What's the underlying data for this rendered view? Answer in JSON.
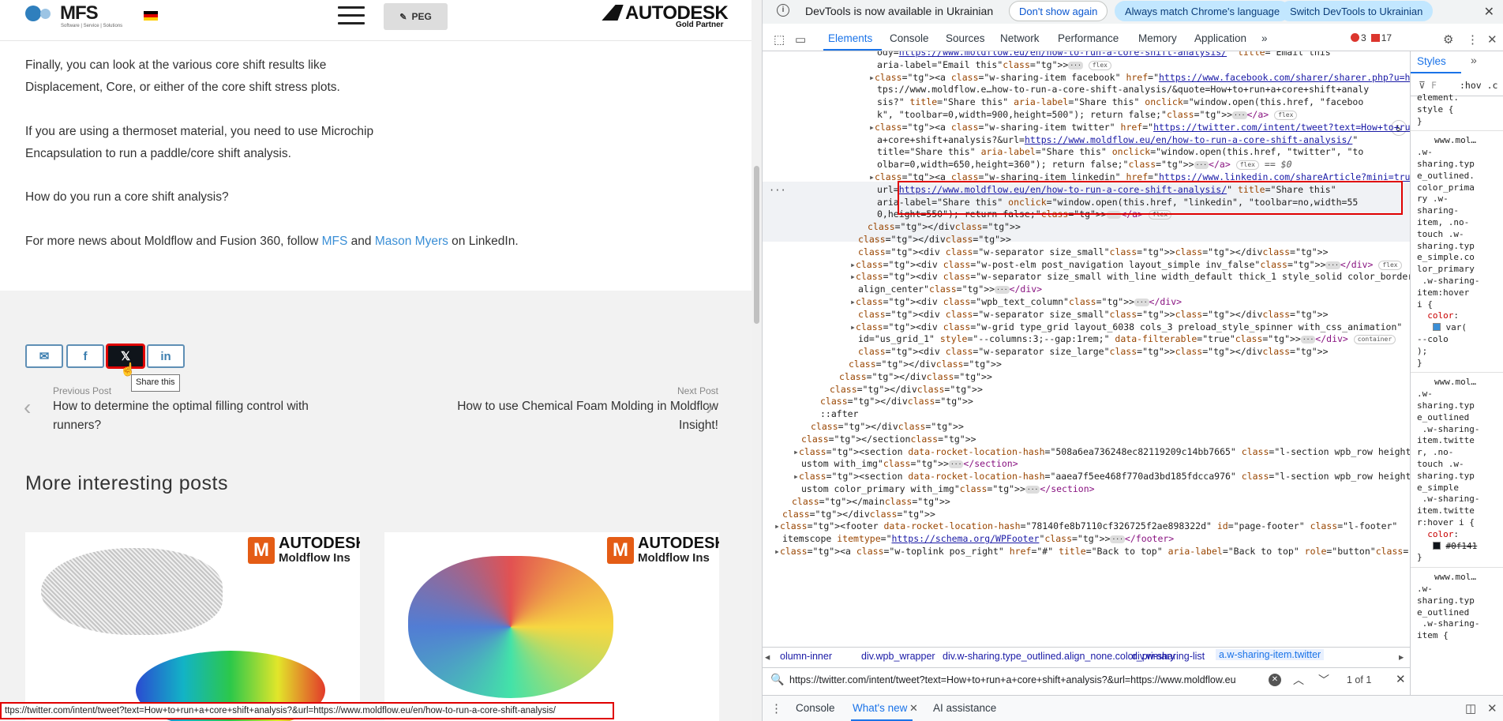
{
  "site": {
    "logo": "MFS",
    "logo_tagline": "Software | Service | Solutions",
    "peg_label": "PEG",
    "partner_brand": "AUTODESK",
    "partner_level": "Gold Partner"
  },
  "article": {
    "p1_l1": "Finally, you can look at the various core shift results like",
    "p1_l2": "Displacement, Core, or either of the core shift stress plots.",
    "p2_l1": "If you are using a thermoset material, you need to use Microchip",
    "p2_l2": "Encapsulation to run a paddle/core shift analysis.",
    "p3": "How do you run a core shift analysis?",
    "p4_pre": "For more news about Moldflow and Fusion 360, follow ",
    "p4_link1": "MFS",
    "p4_mid": " and ",
    "p4_link2": "Mason Myers",
    "p4_post": " on LinkedIn."
  },
  "share": {
    "email_icon": "✉",
    "facebook_icon": "f",
    "twitter_icon": "𝕏",
    "linkedin_icon": "in",
    "tooltip": "Share this"
  },
  "post_nav": {
    "prev_label": "Previous Post",
    "prev_title_l1": "How to determine the optimal filling control with",
    "prev_title_l2": "runners?",
    "next_label": "Next Post",
    "next_title_l1": "How to use Chemical Foam Molding in Moldflow",
    "next_title_l2": "Insight!"
  },
  "more_posts": {
    "heading": "More interesting posts",
    "card_brand": "AUTODESK",
    "card_product": "Moldflow Ins",
    "card_letter": "M"
  },
  "status_url": "https://twitter.com/intent/tweet?text=How+to+run+a+core+shift+analysis?&url=https://www.moldflow.eu/en/how-to-run-a-core-shift-analysis/",
  "status_url_shown": "ttps://twitter.com/intent/tweet?text=How+to+run+a+core+shift+analysis?&url=https://www.moldflow.eu/en/how-to-run-a-core-shift-analysis/",
  "devtools": {
    "info_text": "DevTools is now available in Ukrainian",
    "btn_dont_show": "Don't show again",
    "btn_match": "Always match Chrome's language",
    "btn_switch": "Switch DevTools to Ukrainian",
    "tabs": [
      "Elements",
      "Console",
      "Sources",
      "Network",
      "Performance",
      "Memory",
      "Application"
    ],
    "more_tabs": "»",
    "errors": "3",
    "warnings": "17",
    "styles_tab": "Styles",
    "filter_hint": "F",
    "hov": ":hov .c",
    "breadcrumbs": [
      "olumn-inner",
      "div.wpb_wrapper",
      "div.w-sharing.type_outlined.align_none.color_primary",
      "div.w-sharing-list",
      "a.w-sharing-item.twitter"
    ],
    "search_query": "https://twitter.com/intent/tweet?text=How+to+run+a+core+shift+analysis?&url=https://www.moldflow.eu",
    "search_count": "1 of 1",
    "drawer_tabs": [
      "Console",
      "What's new",
      "AI assistance"
    ]
  },
  "dom_lines": [
    "ody=https://www.moldflow.eu/en/how-to-run-a-core-shift-analysis/\" title=\"Email this\"",
    "aria-label=\"Email this\">",
    "<a class=\"w-sharing-item facebook\" href=\"https://www.facebook.com/sharer/sharer.php?u=ht",
    "tps://www.moldflow.e…how-to-run-a-core-shift-analysis/&quote=How+to+run+a+core+shift+analy",
    "sis?\" title=\"Share this\" aria-label=\"Share this\" onclick=\"window.open(this.href, \"faceboo",
    "k\", \"toolbar=0,width=900,height=500\"); return false;\">",
    "<a class=\"w-sharing-item twitter\" href=\"https://twitter.com/intent/tweet?text=How+to+run+",
    "a+core+shift+analysis?&url=https://www.moldflow.eu/en/how-to-run-a-core-shift-analysis/\"",
    "title=\"Share this\" aria-label=\"Share this\" onclick=\"window.open(this.href, \"twitter\", \"to",
    "olbar=0,width=650,height=360\"); return false;\">",
    "<a class=\"w-sharing-item linkedin\" href=\"https://www.linkedin.com/shareArticle?mini=true&",
    "url=https://www.moldflow.eu/en/how-to-run-a-core-shift-analysis/\" title=\"Share this\"",
    "aria-label=\"Share this\" onclick=\"window.open(this.href, \"linkedin\", \"toolbar=no,width=55",
    "0,height=550\"); return false;\">",
    "</div>",
    "</div>",
    "<div class=\"w-separator size_small\"></div>",
    "<div class=\"w-post-elm post_navigation layout_simple inv_false\">",
    "<div class=\"w-separator size_small with_line width_default thick_1 style_solid color_border",
    "align_center\">",
    "<div class=\"wpb_text_column\">",
    "<div class=\"w-separator size_small\"></div>",
    "<div class=\"w-grid type_grid layout_6038 cols_3 preload_style_spinner with_css_animation\"",
    "id=\"us_grid_1\" style=\"--columns:3;--gap:1rem;\" data-filterable=\"true\">",
    "<div class=\"w-separator size_large\"></div>",
    "</div>",
    "</div>",
    "</div>",
    "</div>",
    "::after",
    "</div>",
    "</section>",
    "<section data-rocket-location-hash=\"508a6ea736248ec82119209c14bb7665\" class=\"l-section wpb_row height_c",
    "ustom with_img\">",
    "<section data-rocket-location-hash=\"aaea7f5ee468f770ad3bd185fdcca976\" class=\"l-section wpb_row height_c",
    "ustom color_primary with_img\">",
    "</main>",
    "</div>",
    "<footer data-rocket-location-hash=\"78140fe8b7110cf326725f2ae898322d\" id=\"page-footer\" class=\"l-footer\"",
    "itemscope itemtype=\"https://schema.org/WPFooter\">",
    "<a class=\"w-toplink pos_right\" href=\"#\" title=\"Back to top\" aria-label=\"Back to top\" role=\"button\">"
  ],
  "dom_badges": {
    "flex": "flex",
    "container": "container",
    "eq0": "== $0",
    "dots": "···"
  },
  "styles_lines": [
    "element.",
    "style {",
    "}",
    "www.mol…",
    ".w-",
    "sharing.typ",
    "e_outlined.",
    "color_prima",
    "ry .w-",
    "sharing-",
    "item, .no-",
    "touch .w-",
    "sharing.typ",
    "e_simple.co",
    "lor_primary",
    " .w-sharing-",
    "item:hover",
    "i {",
    "  color:",
    "var(",
    "--colo",
    ");",
    "}",
    "www.mol…",
    ".w-",
    "sharing.typ",
    "e_outlined",
    " .w-sharing-",
    "item.twitte",
    "r, .no-",
    "touch .w-",
    "sharing.typ",
    "e_simple",
    " .w-sharing-",
    "item.twitte",
    "r:hover i {",
    "  color:",
    "#0f141",
    "}",
    "www.mol…",
    ".w-",
    "sharing.typ",
    "e_outlined",
    " .w-sharing-",
    "item {"
  ],
  "colors": {
    "accent": "#1a73e8",
    "highlight": "#e00000",
    "link": "#3b8fd6",
    "twitter_bg": "#0f141a"
  }
}
